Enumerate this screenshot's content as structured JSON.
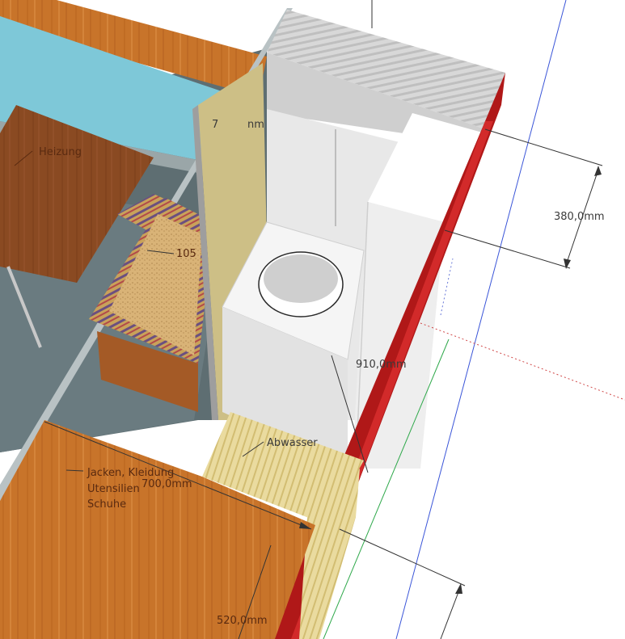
{
  "viewport": {
    "title": ""
  },
  "dimensions": {
    "d380": "380,0mm",
    "d910": "910,0mm",
    "d700": "700,0mm",
    "d520": "520,0mm",
    "d_top_partial": "7",
    "d_top_partial_unit": "nm",
    "d_mid_partial": "105"
  },
  "labels": {
    "heizung": "Heizung",
    "abwasser": "Abwasser",
    "jacken_line1": "Jacken, Kleidung",
    "jacken_line2": "Utensilien",
    "jacken_line3": "Schuhe"
  },
  "colors": {
    "window_glass": "#7ec8d8",
    "wood_floor": "#c8742a",
    "table_top": "#8a4a22",
    "cabinet_white": "#eeeeee",
    "red_wall": "#b01818",
    "floor_grey": "#5e6e72",
    "plywood": "#cdbf86",
    "slat_light": "#e8d9a0"
  }
}
